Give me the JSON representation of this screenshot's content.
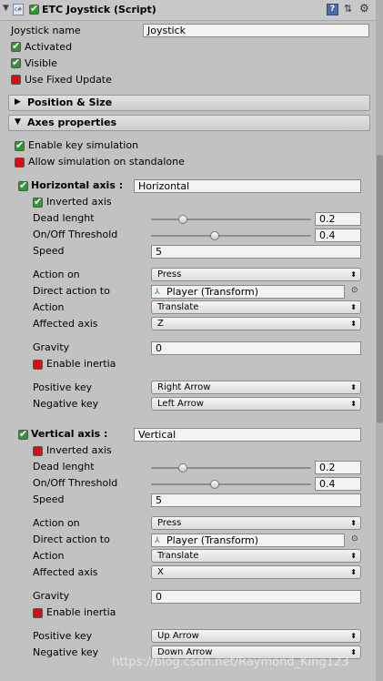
{
  "header": {
    "title": "ETC Joystick (Script)",
    "enabled": true
  },
  "top": {
    "joystick_name_label": "Joystick name",
    "joystick_name_value": "Joystick",
    "activated_label": "Activated",
    "activated": true,
    "visible_label": "Visible",
    "visible": true,
    "fixed_update_label": "Use Fixed Update",
    "fixed_update": false
  },
  "foldouts": {
    "position_size": "Position & Size",
    "axes_properties": "Axes properties"
  },
  "axes": {
    "enable_key_sim_label": "Enable key simulation",
    "enable_key_sim": true,
    "allow_sim_label": "Allow simulation on standalone",
    "allow_sim": false
  },
  "horizontal": {
    "title": "Horizontal axis :",
    "enabled": true,
    "name_value": "Horizontal",
    "inverted_label": "Inverted axis",
    "inverted": true,
    "dead_label": "Dead lenght",
    "dead_value": "0.2",
    "dead_fraction": 0.2,
    "threshold_label": "On/Off Threshold",
    "threshold_value": "0.4",
    "threshold_fraction": 0.4,
    "speed_label": "Speed",
    "speed_value": "5",
    "action_on_label": "Action on",
    "action_on_value": "Press",
    "direct_action_label": "Direct action to",
    "direct_action_value": "Player (Transform)",
    "action_label": "Action",
    "action_value": "Translate",
    "affected_label": "Affected axis",
    "affected_value": "Z",
    "gravity_label": "Gravity",
    "gravity_value": "0",
    "inertia_label": "Enable inertia",
    "inertia": false,
    "positive_label": "Positive key",
    "positive_value": "Right Arrow",
    "negative_label": "Negative key",
    "negative_value": "Left Arrow"
  },
  "vertical": {
    "title": "Vertical axis :",
    "enabled": true,
    "name_value": "Vertical",
    "inverted_label": "Inverted axis",
    "inverted": false,
    "dead_label": "Dead lenght",
    "dead_value": "0.2",
    "dead_fraction": 0.2,
    "threshold_label": "On/Off Threshold",
    "threshold_value": "0.4",
    "threshold_fraction": 0.4,
    "speed_label": "Speed",
    "speed_value": "5",
    "action_on_label": "Action on",
    "action_on_value": "Press",
    "direct_action_label": "Direct action to",
    "direct_action_value": "Player (Transform)",
    "action_label": "Action",
    "action_value": "Translate",
    "affected_label": "Affected axis",
    "affected_value": "X",
    "gravity_label": "Gravity",
    "gravity_value": "0",
    "inertia_label": "Enable inertia",
    "inertia": false,
    "positive_label": "Positive key",
    "positive_value": "Up Arrow",
    "negative_label": "Negative key",
    "negative_value": "Down Arrow"
  },
  "watermark": "https://blog.csdn.net/Raymond_King123"
}
